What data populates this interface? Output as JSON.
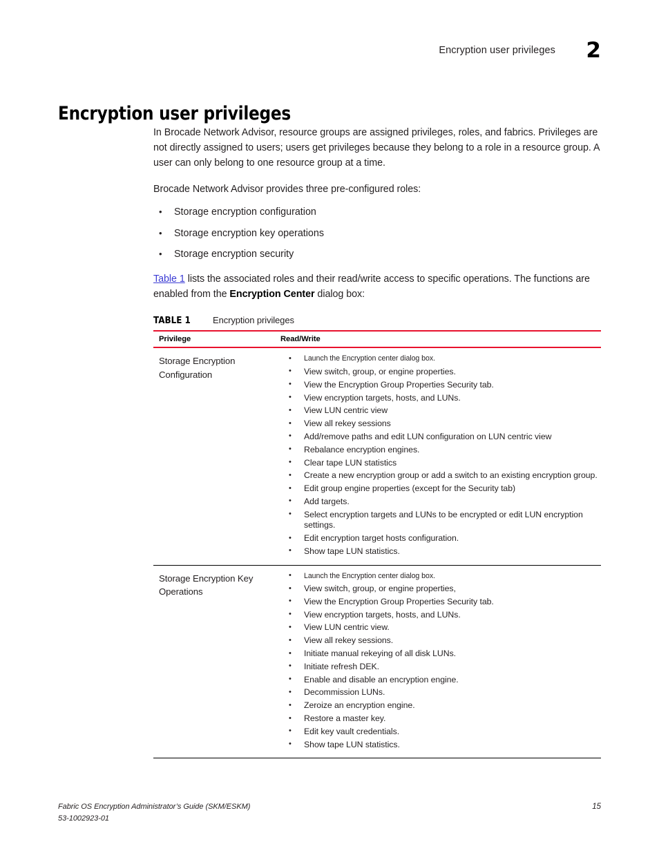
{
  "header": {
    "chapter_title": "Encryption user privileges",
    "chapter_number": "2"
  },
  "section": {
    "heading": "Encryption user privileges"
  },
  "intro": {
    "paragraph_1": "In Brocade Network Advisor, resource groups are assigned privileges, roles, and fabrics. Privileges are not directly assigned to users; users get privileges because they belong to a role in a resource group. A user can only belong to one resource group at a time.",
    "paragraph_2": "Brocade Network Advisor provides three pre-configured roles:",
    "roles": [
      "Storage encryption configuration",
      "Storage encryption key operations",
      "Storage encryption security"
    ],
    "xref_link": "Table 1",
    "xref_text_1": " lists the associated roles and their read/write access to specific operations. The functions are enabled from the ",
    "xref_bold": "Encryption Center",
    "xref_text_2": " dialog box:",
    "bullet_glyph": "•"
  },
  "table": {
    "caption_label": "TABLE 1",
    "caption_title": "Encryption privileges",
    "columns": [
      "Privilege",
      "Read/Write"
    ],
    "bullet_glyph": "•",
    "rows": [
      {
        "privilege": "Storage Encryption Configuration",
        "operations": [
          "Launch the Encryption center dialog box.",
          "View switch, group, or engine properties.",
          "View the Encryption Group Properties Security tab.",
          "View encryption targets, hosts, and LUNs.",
          "View LUN centric view",
          "View all rekey sessions",
          "Add/remove paths and edit LUN configuration on LUN centric view",
          "Rebalance encryption engines.",
          "Clear tape LUN statistics",
          "Create a new encryption group or add a switch to an existing encryption group.",
          "Edit group engine properties (except for the Security tab)",
          "Add targets.",
          "Select encryption targets and LUNs to be encrypted or edit LUN encryption settings.",
          "Edit encryption target hosts configuration.",
          "Show tape LUN statistics."
        ]
      },
      {
        "privilege": "Storage Encryption Key Operations",
        "operations": [
          "Launch the Encryption center dialog box.",
          "View switch, group, or engine properties,",
          "View the Encryption Group Properties Security tab.",
          "View encryption targets, hosts, and LUNs.",
          "View LUN centric view.",
          "View all rekey sessions.",
          "Initiate manual rekeying of all disk LUNs.",
          "Initiate refresh DEK.",
          "Enable and disable an encryption engine.",
          "Decommission LUNs.",
          "Zeroize an encryption engine.",
          "Restore a master key.",
          "Edit key vault credentials.",
          "Show tape LUN statistics."
        ]
      }
    ]
  },
  "footer": {
    "document_title": "Fabric OS Encryption Administrator’s Guide (SKM/ESKM)",
    "document_number": "53-1002923-01",
    "page_number": "15"
  },
  "colors": {
    "accent_red": "#e8112d",
    "link_blue": "#3b3bd4",
    "body_text": "#231f20"
  }
}
